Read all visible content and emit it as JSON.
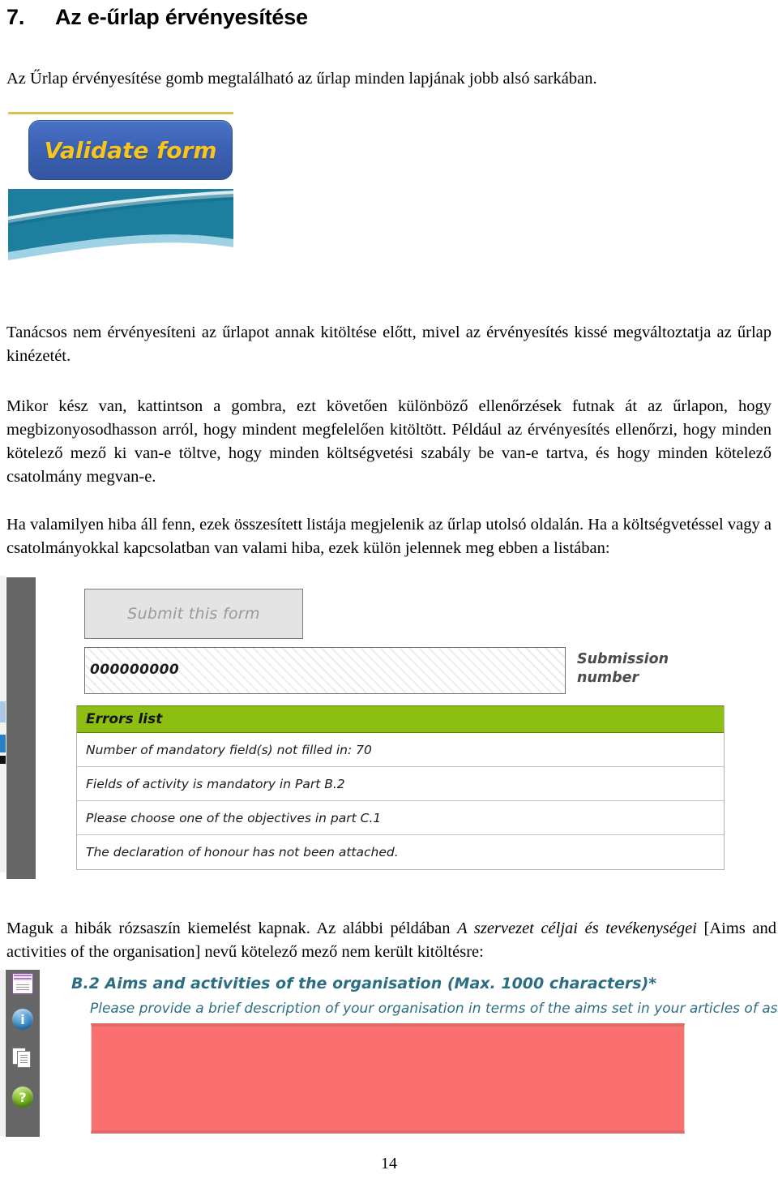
{
  "heading": {
    "number": "7.",
    "title": "Az e-űrlap érvényesítése"
  },
  "paragraphs": {
    "intro": "Az Űrlap érvényesítése gomb megtalálható az űrlap minden lapjának jobb alsó sarkában.",
    "advice": "Tanácsos nem érvényesíteni az űrlapot annak kitöltése előtt, mivel az érvényesítés kissé megváltoztatja az űrlap kinézetét.",
    "checks": "Mikor kész van, kattintson a gombra, ezt követően különböző ellenőrzések futnak át az űrlapon, hogy megbizonyosodhasson arról, hogy mindent megfelelően kitöltött. Például az érvényesítés ellenőrzi, hogy minden kötelező mező ki van-e töltve, hogy minden költségvetési szabály be van-e tartva, és hogy minden kötelező csatolmány megvan-e.",
    "errors": "Ha valamilyen hiba áll fenn, ezek összesített listája megjelenik az űrlap utolsó oldalán. Ha a költségvetéssel vagy a csatolmányokkal kapcsolatban van valami hiba, ezek külön jelennek meg ebben a listában:",
    "highlight_before": "Maguk a hibák rózsaszín kiemelést kapnak. Az alábbi példában ",
    "highlight_italic": "A szervezet céljai és tevékenységei",
    "highlight_after": " [Aims and activities of the organisation] nevű kötelező mező nem került kitöltésre:"
  },
  "validate_figure": {
    "button_label": "Validate form",
    "button_color": "#3b61b5",
    "label_color": "#f7c51e",
    "accent_line_color": "#d9c24a",
    "banner_color": "#1e7e9e"
  },
  "errors_figure": {
    "submit_button_label": "Submit  this form",
    "submission_number_value": "000000000",
    "submission_number_label": "Submission number",
    "errors_list_title": "Errors list",
    "errors_list_color": "#8cbf11",
    "rows": [
      "Number of mandatory field(s) not filled in: 70",
      "Fields of activity is mandatory in Part B.2",
      "Please choose one of the objectives in part C.1",
      "The declaration of honour has not been attached."
    ],
    "sidebar_color": "#666666"
  },
  "aims_figure": {
    "heading": "B.2 Aims and activities of the organisation (Max. 1000 characters)*",
    "instruction": "Please provide a brief description of your organisation in terms of the aims set in your articles of association.",
    "heading_color": "#2b6e84",
    "field_color": "#fa7070",
    "field_value": "",
    "sidebar_icons": [
      "purple-document-icon",
      "info-icon",
      "pages-icon",
      "help-icon"
    ]
  },
  "footer": {
    "page_number": "14"
  }
}
